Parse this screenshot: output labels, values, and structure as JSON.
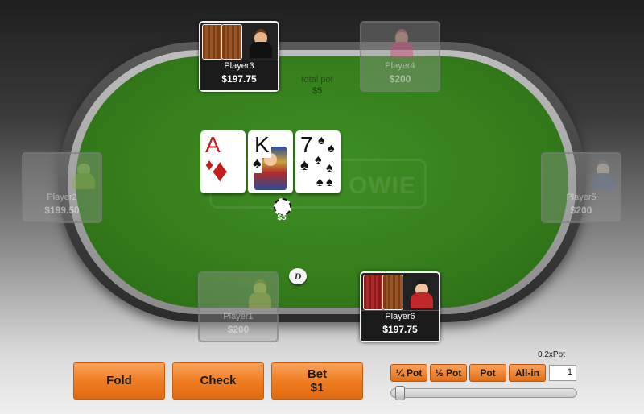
{
  "table": {
    "watermark": "OWIE",
    "total_pot_label": "total pot",
    "total_pot_value": "$5",
    "pot_chip_value": "$5",
    "dealer_button": "D"
  },
  "board": [
    {
      "rank": "A",
      "suit": "♦",
      "color": "#c21d1d"
    },
    {
      "rank": "K",
      "suit": "♠",
      "color": "#111111"
    },
    {
      "rank": "7",
      "suit": "♠",
      "color": "#111111"
    }
  ],
  "seats": {
    "player1": {
      "name": "Player1",
      "stack": "$200",
      "state": "inactive"
    },
    "player2": {
      "name": "Player2",
      "stack": "$199.50",
      "state": "inactive"
    },
    "player3": {
      "name": "Player3",
      "stack": "$197.75",
      "state": "active"
    },
    "player4": {
      "name": "Player4",
      "stack": "$200",
      "state": "inactive"
    },
    "player5": {
      "name": "Player5",
      "stack": "$200",
      "state": "inactive"
    },
    "player6": {
      "name": "Player6",
      "stack": "$197.75",
      "state": "active"
    }
  },
  "actions": {
    "fold_label": "Fold",
    "check_label": "Check",
    "bet_label": "Bet",
    "bet_amount": "$1"
  },
  "bet_sizing": {
    "quarter_pot": "¼ Pot",
    "half_pot": "½ Pot",
    "pot": "Pot",
    "all_in": "All-in",
    "multiplier_label": "0.2xPot",
    "input_value": "1",
    "slider_level": 0.02
  },
  "colors": {
    "felt": "#357e1c",
    "action_orange": "#f07d22"
  }
}
